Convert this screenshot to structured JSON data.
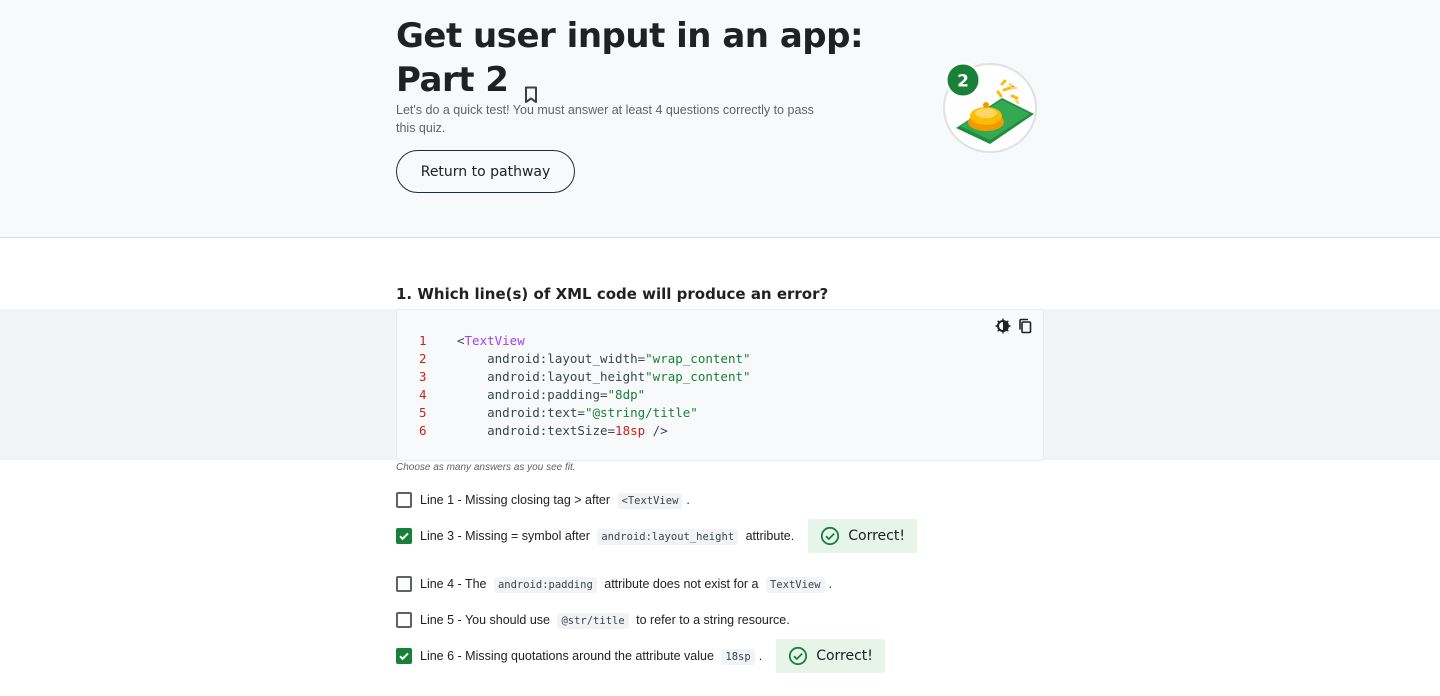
{
  "header": {
    "title_line1": "Get user input in an app:",
    "title_line2": "Part 2",
    "description": "Let's do a quick test! You must answer at least 4 questions correctly to pass this quiz.",
    "return_button": "Return to pathway",
    "badge_number": "2"
  },
  "question": {
    "title": "1. Which line(s) of XML code will produce an error?",
    "code": [
      {
        "n": "1",
        "parts": [
          [
            "plain",
            "<"
          ],
          [
            "tag",
            "TextView"
          ]
        ]
      },
      {
        "n": "2",
        "parts": [
          [
            "plain",
            "    android:layout_width="
          ],
          [
            "str",
            "\"wrap_content\""
          ]
        ]
      },
      {
        "n": "3",
        "parts": [
          [
            "plain",
            "    android:layout_height"
          ],
          [
            "str",
            "\"wrap_content\""
          ]
        ]
      },
      {
        "n": "4",
        "parts": [
          [
            "plain",
            "    android:padding="
          ],
          [
            "str",
            "\"8dp\""
          ]
        ]
      },
      {
        "n": "5",
        "parts": [
          [
            "plain",
            "    android:text="
          ],
          [
            "str",
            "\"@string/title\""
          ]
        ]
      },
      {
        "n": "6",
        "parts": [
          [
            "plain",
            "    android:textSize="
          ],
          [
            "num",
            "18sp"
          ],
          [
            "plain",
            " />"
          ]
        ]
      }
    ],
    "hint": "Choose as many answers as you see fit.",
    "correct_label": "Correct!",
    "answers": [
      {
        "checked": false,
        "correct": false,
        "parts": [
          [
            "t",
            "Line 1 - Missing closing tag > after "
          ],
          [
            "c",
            "<TextView"
          ],
          [
            "t",
            "."
          ]
        ]
      },
      {
        "checked": true,
        "correct": true,
        "parts": [
          [
            "t",
            "Line 3 - Missing = symbol after "
          ],
          [
            "c",
            "android:layout_height"
          ],
          [
            "t",
            " attribute."
          ]
        ]
      },
      {
        "checked": false,
        "correct": false,
        "parts": [
          [
            "t",
            "Line 4 - The "
          ],
          [
            "c",
            "android:padding"
          ],
          [
            "t",
            " attribute does not exist for a "
          ],
          [
            "c",
            "TextView"
          ],
          [
            "t",
            "."
          ]
        ]
      },
      {
        "checked": false,
        "correct": false,
        "parts": [
          [
            "t",
            "Line 5 - You should use "
          ],
          [
            "c",
            "@str/title"
          ],
          [
            "t",
            " to refer to a string resource."
          ]
        ]
      },
      {
        "checked": true,
        "correct": true,
        "parts": [
          [
            "t",
            "Line 6 - Missing quotations around the attribute value "
          ],
          [
            "c",
            "18sp"
          ],
          [
            "t",
            "."
          ]
        ]
      }
    ]
  },
  "colors": {
    "accent_green": "#188038",
    "correct_bg": "#e6f4ea",
    "hero_bg": "#f8f9fa"
  },
  "icons": [
    "bookmark-icon",
    "theme-toggle-icon",
    "copy-icon",
    "check-icon",
    "check-circle-icon"
  ]
}
